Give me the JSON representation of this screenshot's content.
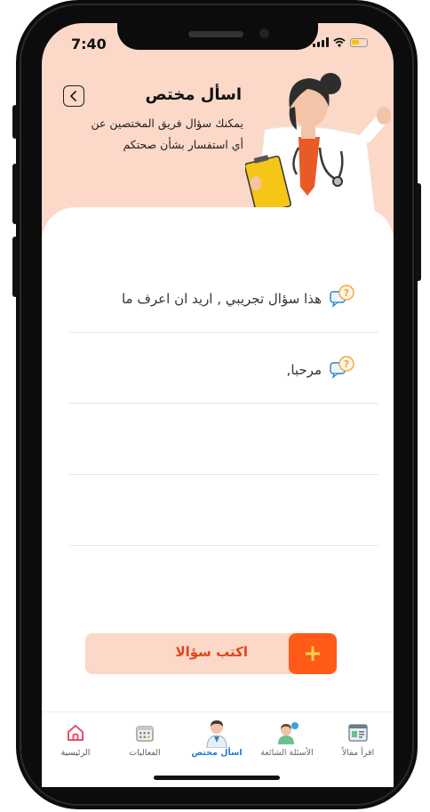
{
  "status": {
    "time": "7:40"
  },
  "header": {
    "title": "اسأل مختص",
    "subtitle_line1": "يمكنك سؤال فريق المختصين عن",
    "subtitle_line2": "أي استفسار بشأن صحتكم"
  },
  "questions": [
    {
      "text": "هذا سؤال تجريبي , اريد ان اعرف ما"
    },
    {
      "text": "مرحبا,"
    },
    {
      "text": ""
    },
    {
      "text": ""
    }
  ],
  "write_button": {
    "label": "اكتب سؤالا",
    "plus": "+"
  },
  "tabs": [
    {
      "label": "الرئيسية",
      "icon": "home-icon"
    },
    {
      "label": "الفعاليات",
      "icon": "calendar-icon"
    },
    {
      "label": "اسأل مختص",
      "icon": "doctor-icon"
    },
    {
      "label": "الأسئلة الشائعة",
      "icon": "faq-avatar-icon"
    },
    {
      "label": "اقرأ مقالاً",
      "icon": "article-icon"
    }
  ],
  "colors": {
    "header_bg": "#fbd8c8",
    "accent": "#ff5a17",
    "active_tab": "#1b7bd6",
    "home_tab": "#e4506a"
  }
}
